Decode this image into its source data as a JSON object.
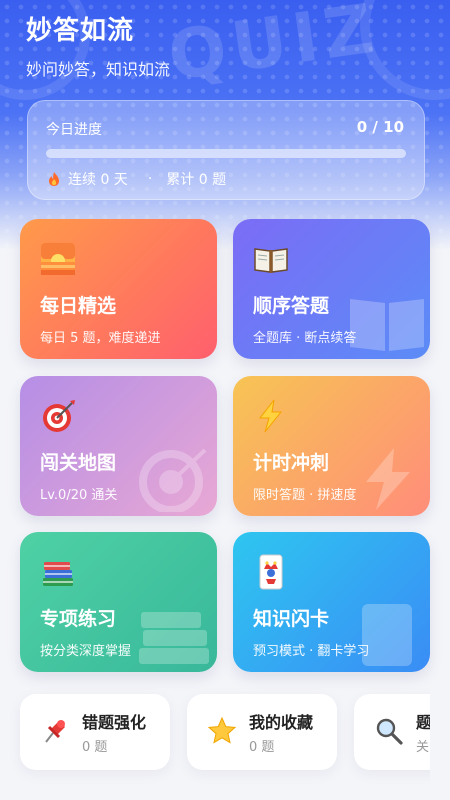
{
  "header": {
    "title": "妙答如流",
    "subtitle": "妙问妙答，知识如流",
    "deco_text": "QUIZ"
  },
  "progress": {
    "label": "今日进度",
    "count_text": "0 / 10",
    "fraction": 0,
    "streak_text": "连续 0 天",
    "separator": "·",
    "total_text": "累计 0 题"
  },
  "tiles": [
    {
      "title": "每日精选",
      "subtitle": "每日 5 题，难度递进",
      "icon": "sunrise-icon",
      "color_from": "#ff9a4a",
      "color_to": "#ff5f6d"
    },
    {
      "title": "顺序答题",
      "subtitle": "全题库 · 断点续答",
      "icon": "open-book-icon",
      "color_from": "#7b6cf6",
      "color_to": "#5b8cf7"
    },
    {
      "title": "闯关地图",
      "subtitle": "Lv.0/20 通关",
      "icon": "target-icon",
      "color_from": "#b58ee6",
      "color_to": "#e8a8d4"
    },
    {
      "title": "计时冲刺",
      "subtitle": "限时答题 · 拼速度",
      "icon": "lightning-icon",
      "color_from": "#f7c453",
      "color_to": "#ff8d7a"
    },
    {
      "title": "专项练习",
      "subtitle": "按分类深度掌握",
      "icon": "books-icon",
      "color_from": "#4fd1a5",
      "color_to": "#38b89a"
    },
    {
      "title": "知识闪卡",
      "subtitle": "预习模式 · 翻卡学习",
      "icon": "joker-card-icon",
      "color_from": "#2ec6f0",
      "color_to": "#3a8cf5"
    }
  ],
  "quick_links": [
    {
      "title": "错题强化",
      "subtitle": "0 题",
      "icon": "pushpin-icon"
    },
    {
      "title": "我的收藏",
      "subtitle": "0 题",
      "icon": "star-icon"
    },
    {
      "title": "题",
      "subtitle": "关",
      "icon": "magnifier-icon"
    }
  ]
}
